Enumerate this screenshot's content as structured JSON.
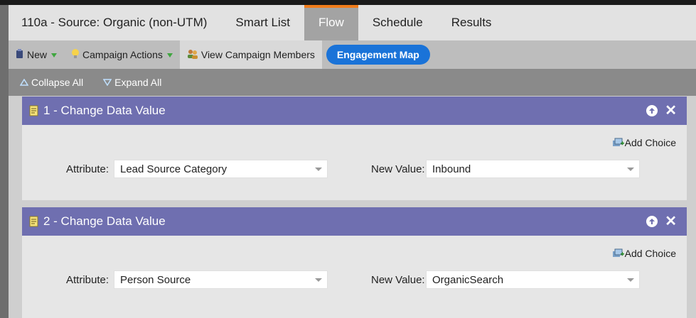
{
  "tabs": {
    "title": "110a - Source: Organic (non-UTM)",
    "items": [
      "Smart List",
      "Flow",
      "Schedule",
      "Results"
    ],
    "active": "Flow"
  },
  "toolbar": {
    "new_label": "New",
    "campaign_actions_label": "Campaign Actions",
    "view_members_label": "View Campaign Members",
    "engagement_map_label": "Engagement Map"
  },
  "collapse": {
    "collapse_all": "Collapse All",
    "expand_all": "Expand All"
  },
  "steps": [
    {
      "title": "1 - Change Data Value",
      "add_choice": "Add Choice",
      "attribute_label": "Attribute:",
      "attribute_value": "Lead Source Category",
      "new_value_label": "New Value:",
      "new_value": "Inbound"
    },
    {
      "title": "2 - Change Data Value",
      "add_choice": "Add Choice",
      "attribute_label": "Attribute:",
      "attribute_value": "Person Source",
      "new_value_label": "New Value:",
      "new_value": "OrganicSearch"
    }
  ],
  "colors": {
    "active_tab_accent": "#f07c1b",
    "step_header": "#6f6fb0",
    "engagement_button": "#1a73d8"
  }
}
